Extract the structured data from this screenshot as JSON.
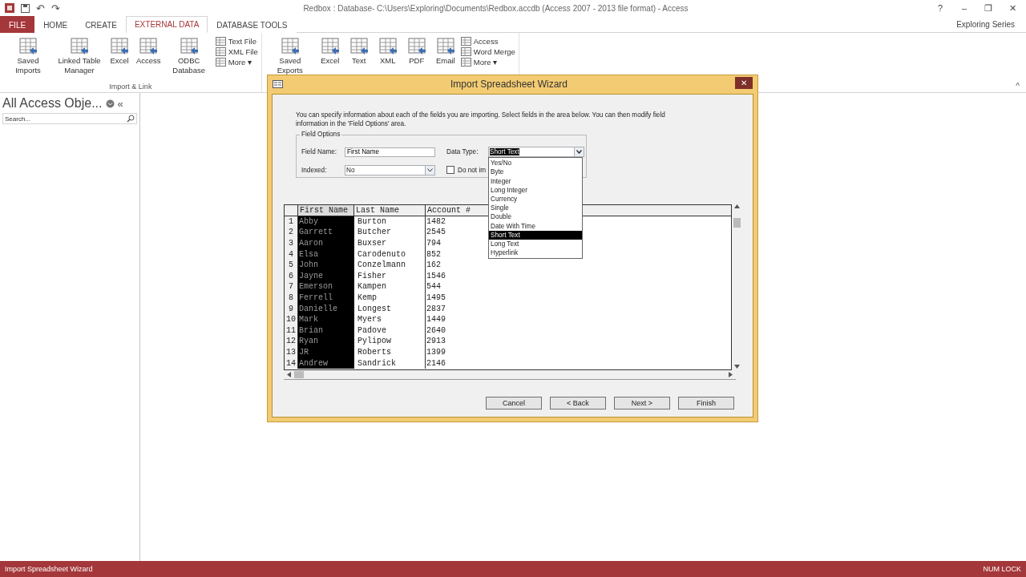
{
  "window": {
    "title": "Redbox : Database- C:\\Users\\Exploring\\Documents\\Redbox.accdb (Access 2007 - 2013 file format) - Access",
    "controls": [
      "?",
      "–",
      "❐",
      "✕"
    ],
    "quick_access": [
      "↶",
      "↷"
    ]
  },
  "tabs": [
    {
      "label": "FILE",
      "kind": "file",
      "selected": false
    },
    {
      "label": "HOME",
      "kind": "tab",
      "selected": false
    },
    {
      "label": "CREATE",
      "kind": "tab",
      "selected": false
    },
    {
      "label": "EXTERNAL DATA",
      "kind": "tab",
      "selected": true
    },
    {
      "label": "DATABASE TOOLS",
      "kind": "tab",
      "selected": false
    }
  ],
  "account": {
    "name": "Exploring Series"
  },
  "ribbon": {
    "groups": [
      {
        "label": "Import & Link",
        "buttons": [
          {
            "kind": "large",
            "label": "Saved Imports"
          },
          {
            "kind": "large",
            "label": "Linked Table Manager"
          },
          {
            "kind": "large",
            "label": "Excel"
          },
          {
            "kind": "large",
            "label": "Access"
          },
          {
            "kind": "large",
            "label": "ODBC Database"
          },
          {
            "kind": "small",
            "label": "Text File"
          },
          {
            "kind": "small",
            "label": "XML File"
          },
          {
            "kind": "small",
            "label": "More ▾"
          }
        ]
      },
      {
        "buttons": [
          {
            "kind": "large",
            "label": "Saved Exports"
          },
          {
            "kind": "large",
            "label": "Excel"
          },
          {
            "kind": "large",
            "label": "Text"
          },
          {
            "kind": "large",
            "label": "XML"
          },
          {
            "kind": "large",
            "label": "PDF"
          },
          {
            "kind": "large",
            "label": "Email"
          },
          {
            "kind": "small",
            "label": "Access"
          },
          {
            "kind": "small",
            "label": "Word Merge"
          },
          {
            "kind": "small",
            "label": "More ▾"
          }
        ]
      }
    ]
  },
  "nav_pane": {
    "title": "All Access Obje...",
    "search": {
      "placeholder": "Search..."
    },
    "collapse": "«"
  },
  "ribbon_collapse": "^",
  "dialog": {
    "title": "Import Spreadsheet Wizard",
    "close": "✕",
    "instructions": "You can specify information about each of the fields you are importing. Select fields in the area below. You can then modify field information in the 'Field Options' area.",
    "field_options": {
      "legend": "Field Options",
      "field_name_label": "Field Name:",
      "field_name_value": "First Name",
      "data_type_label": "Data Type:",
      "data_type_value": "Short Text",
      "indexed_label": "Indexed:",
      "indexed_value": "No",
      "do_not_import_label": "Do not im",
      "do_not_import_checked": false
    },
    "data_type_options": [
      {
        "label": "Yes/No",
        "selected": false
      },
      {
        "label": "Byte",
        "selected": false
      },
      {
        "label": "Integer",
        "selected": false
      },
      {
        "label": "Long Integer",
        "selected": false
      },
      {
        "label": "Currency",
        "selected": false
      },
      {
        "label": "Single",
        "selected": false
      },
      {
        "label": "Double",
        "selected": false
      },
      {
        "label": "Date With Time",
        "selected": false
      },
      {
        "label": "Short Text",
        "selected": true
      },
      {
        "label": "Long Text",
        "selected": false
      },
      {
        "label": "Hyperlink",
        "selected": false
      }
    ],
    "preview": {
      "columns": [
        {
          "label": "First Name",
          "selected": true
        },
        {
          "label": "Last Name",
          "selected": false
        },
        {
          "label": "Account #",
          "selected": false
        }
      ],
      "rows": [
        {
          "number": "1",
          "cells": [
            "Abby",
            "Burton",
            "1482"
          ]
        },
        {
          "number": "2",
          "cells": [
            "Garrett",
            "Butcher",
            "2545"
          ]
        },
        {
          "number": "3",
          "cells": [
            "Aaron",
            "Buxser",
            "794"
          ]
        },
        {
          "number": "4",
          "cells": [
            "Elsa",
            "Carodenuto",
            "852"
          ]
        },
        {
          "number": "5",
          "cells": [
            "John",
            "Conzelmann",
            "162"
          ]
        },
        {
          "number": "6",
          "cells": [
            "Jayne",
            "Fisher",
            "1546"
          ]
        },
        {
          "number": "7",
          "cells": [
            "Emerson",
            "Kampen",
            "544"
          ]
        },
        {
          "number": "8",
          "cells": [
            "Ferrell",
            "Kemp",
            "1495"
          ]
        },
        {
          "number": "9",
          "cells": [
            "Danielle",
            "Longest",
            "2837"
          ]
        },
        {
          "number": "10",
          "cells": [
            "Mark",
            "Myers",
            "1449"
          ]
        },
        {
          "number": "11",
          "cells": [
            "Brian",
            "Padove",
            "2640"
          ]
        },
        {
          "number": "12",
          "cells": [
            "Ryan",
            "Pylipow",
            "2913"
          ]
        },
        {
          "number": "13",
          "cells": [
            "JR",
            "Roberts",
            "1399"
          ]
        },
        {
          "number": "14",
          "cells": [
            "Andrew",
            "Sandrick",
            "2146"
          ]
        }
      ]
    },
    "buttons": [
      {
        "label": "Cancel"
      },
      {
        "label": "< Back"
      },
      {
        "label": "Next >"
      },
      {
        "label": "Finish"
      }
    ]
  },
  "status_bar": {
    "left": "Import Spreadsheet Wizard",
    "right": "NUM LOCK"
  }
}
